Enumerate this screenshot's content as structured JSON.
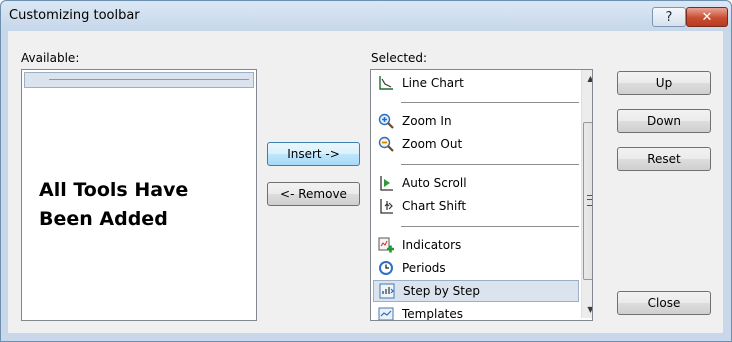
{
  "window": {
    "title": "Customizing toolbar",
    "help_label": "?",
    "close_label": "✕"
  },
  "available": {
    "label": "Available:",
    "overlay_line1": "All Tools Have",
    "overlay_line2": "Been Added"
  },
  "buttons": {
    "insert": "Insert ->",
    "remove": "<- Remove",
    "up": "Up",
    "down": "Down",
    "reset": "Reset",
    "close": "Close"
  },
  "selected": {
    "label": "Selected:",
    "items": [
      {
        "label": "Line Chart",
        "icon": "line-chart-icon"
      },
      {
        "label": "Zoom In",
        "icon": "zoom-in-icon"
      },
      {
        "label": "Zoom Out",
        "icon": "zoom-out-icon"
      },
      {
        "label": "Auto Scroll",
        "icon": "auto-scroll-icon"
      },
      {
        "label": "Chart Shift",
        "icon": "chart-shift-icon"
      },
      {
        "label": "Indicators",
        "icon": "indicators-icon"
      },
      {
        "label": "Periods",
        "icon": "periods-icon"
      },
      {
        "label": "Step by Step",
        "icon": "step-by-step-icon",
        "selected": true
      },
      {
        "label": "Templates",
        "icon": "templates-icon"
      }
    ]
  },
  "colors": {
    "highlight": "#dbe4ee",
    "title_bar": "#c8d8ea",
    "close_button": "#c84d32"
  }
}
